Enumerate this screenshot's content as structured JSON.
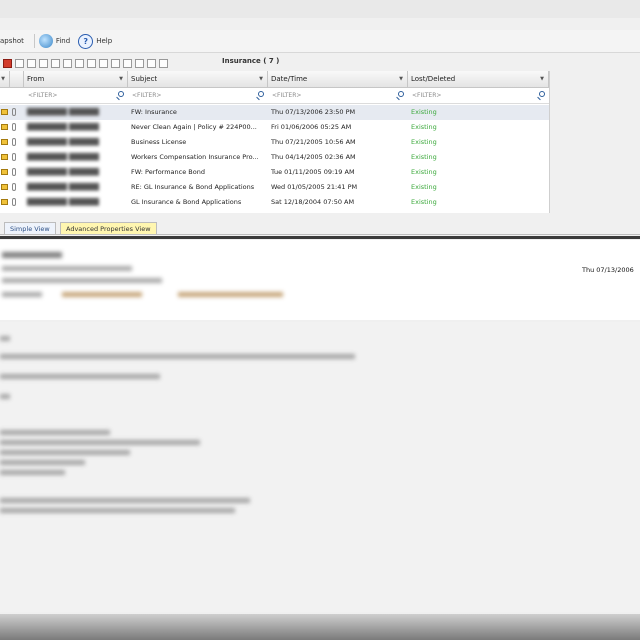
{
  "toolbar": {
    "snapshot_label": "apshot",
    "find_label": "Find",
    "help_label": "Help"
  },
  "folder_title": "Insurance ( 7 )",
  "grid": {
    "columns": [
      "From",
      "Subject",
      "Date/Time",
      "Lost/Deleted"
    ],
    "filter_placeholder": "<FILTER>",
    "rows": [
      {
        "subject": "FW: Insurance",
        "date": "Thu 07/13/2006 23:50 PM",
        "status": "Existing"
      },
      {
        "subject": "Never Clean Again  |  Policy # 224P00...",
        "date": "Fri 01/06/2006 05:25 AM",
        "status": "Existing"
      },
      {
        "subject": "Business License",
        "date": "Thu 07/21/2005 10:56 AM",
        "status": "Existing"
      },
      {
        "subject": "Workers Compensation Insurance Pro...",
        "date": "Thu 04/14/2005 02:36 AM",
        "status": "Existing"
      },
      {
        "subject": "FW: Performance Bond",
        "date": "Tue 01/11/2005 09:19 AM",
        "status": "Existing"
      },
      {
        "subject": "RE: GL Insurance & Bond Applications",
        "date": "Wed 01/05/2005 21:41 PM",
        "status": "Existing"
      },
      {
        "subject": "GL Insurance & Bond Applications",
        "date": "Sat 12/18/2004 07:50 AM",
        "status": "Existing"
      }
    ]
  },
  "tabs": {
    "simple": "Simple View",
    "advanced": "Advanced Properties View"
  },
  "preview": {
    "date": "Thu 07/13/2006"
  },
  "colors": {
    "existing_status": "#3aa83a",
    "advanced_tab": "#fff6b0",
    "divider": "#3a3a3a"
  }
}
